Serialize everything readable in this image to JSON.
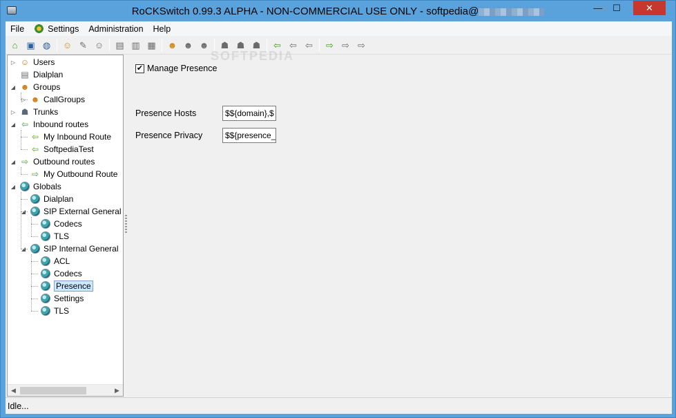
{
  "window": {
    "title_prefix": "RoCKSwitch 0.99.3 ALPHA - NON-COMMERCIAL USE ONLY - softpedia@",
    "minimize_glyph": "—",
    "maximize_glyph": "☐",
    "close_glyph": "✕"
  },
  "menu": {
    "items": [
      {
        "label": "File"
      },
      {
        "label": "Settings",
        "icon": "settings-gear-icon"
      },
      {
        "label": "Administration"
      },
      {
        "label": "Help"
      }
    ]
  },
  "toolbar": {
    "groups": [
      [
        "home-refresh-icon",
        "save-icon",
        "web-export-icon"
      ],
      [
        "add-user-icon",
        "edit-user-icon",
        "remove-user-icon"
      ],
      [
        "add-dialplan-icon",
        "edit-dialplan-icon",
        "remove-dialplan-icon"
      ],
      [
        "add-group-icon",
        "edit-group-icon",
        "remove-group-icon"
      ],
      [
        "add-trunk-icon",
        "edit-trunk-icon",
        "remove-trunk-icon"
      ],
      [
        "add-inbound-route-icon",
        "edit-inbound-route-icon",
        "remove-inbound-route-icon"
      ],
      [
        "add-outbound-route-icon",
        "edit-outbound-route-icon",
        "remove-outbound-route-icon"
      ]
    ]
  },
  "tree": {
    "nodes": [
      {
        "label": "Users",
        "icon": "user-icon",
        "level": 0,
        "expander": "▷"
      },
      {
        "label": "Dialplan",
        "icon": "dialplan-icon",
        "level": 0,
        "expander": ""
      },
      {
        "label": "Groups",
        "icon": "group-icon",
        "level": 0,
        "expander": "◢"
      },
      {
        "label": "CallGroups",
        "icon": "group-icon",
        "level": 1,
        "expander": "▷"
      },
      {
        "label": "Trunks",
        "icon": "trunk-icon",
        "level": 0,
        "expander": "▷"
      },
      {
        "label": "Inbound routes",
        "icon": "inbound-arrow-icon",
        "level": 0,
        "expander": "◢"
      },
      {
        "label": "My Inbound Route",
        "icon": "inbound-arrow-icon",
        "level": 1,
        "expander": ""
      },
      {
        "label": "SoftpediaTest",
        "icon": "inbound-arrow-icon",
        "level": 1,
        "expander": ""
      },
      {
        "label": "Outbound routes",
        "icon": "outbound-arrow-icon",
        "level": 0,
        "expander": "◢"
      },
      {
        "label": "My Outbound Route",
        "icon": "outbound-arrow-icon",
        "level": 1,
        "expander": ""
      },
      {
        "label": "Globals",
        "icon": "globe-icon",
        "level": 0,
        "expander": "◢"
      },
      {
        "label": "Dialplan",
        "icon": "globe-icon",
        "level": 1,
        "expander": ""
      },
      {
        "label": "SIP External General",
        "icon": "globe-icon",
        "level": 1,
        "expander": "◢"
      },
      {
        "label": "Codecs",
        "icon": "globe-icon",
        "level": 2,
        "expander": ""
      },
      {
        "label": "TLS",
        "icon": "globe-icon",
        "level": 2,
        "expander": ""
      },
      {
        "label": "SIP Internal General",
        "icon": "globe-icon",
        "level": 1,
        "expander": "◢"
      },
      {
        "label": "ACL",
        "icon": "globe-icon",
        "level": 2,
        "expander": ""
      },
      {
        "label": "Codecs",
        "icon": "globe-icon",
        "level": 2,
        "expander": ""
      },
      {
        "label": "Presence",
        "icon": "globe-icon",
        "level": 2,
        "expander": "",
        "selected": true
      },
      {
        "label": "Settings",
        "icon": "globe-icon",
        "level": 2,
        "expander": ""
      },
      {
        "label": "TLS",
        "icon": "globe-icon",
        "level": 2,
        "expander": ""
      }
    ]
  },
  "form": {
    "manage_presence": {
      "label": "Manage Presence",
      "checked": true,
      "check_glyph": "✔"
    },
    "presence_hosts": {
      "label": "Presence Hosts",
      "value": "$${domain},$"
    },
    "presence_privacy": {
      "label": "Presence Privacy",
      "value": "$${presence_p"
    }
  },
  "status": {
    "text": "Idle..."
  },
  "watermark": {
    "text": "SOFTPEDIA"
  }
}
